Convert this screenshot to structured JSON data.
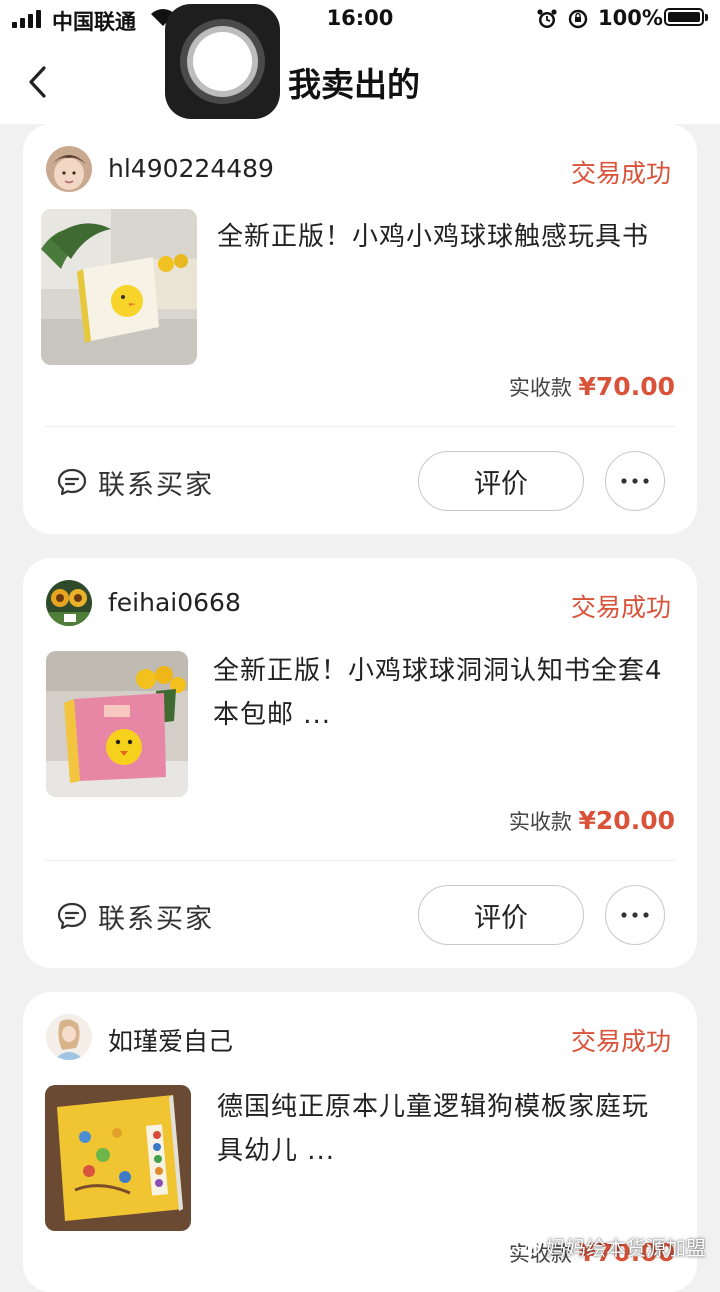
{
  "status_bar": {
    "carrier": "中国联通",
    "time": "16:00",
    "battery": "100%"
  },
  "nav": {
    "title": "我卖出的"
  },
  "orders": [
    {
      "username": "hl490224489",
      "status": "交易成功",
      "title": "全新正版！小鸡小鸡球球触感玩具书",
      "price_label": "实收款",
      "price": "¥70.00",
      "contact_label": "联系买家",
      "review_label": "评价",
      "more_label": "···"
    },
    {
      "username": "feihai0668",
      "status": "交易成功",
      "title": "全新正版！小鸡球球洞洞认知书全套4本包邮 ...",
      "price_label": "实收款",
      "price": "¥20.00",
      "contact_label": "联系买家",
      "review_label": "评价",
      "more_label": "···"
    },
    {
      "username": "如瑾爱自己",
      "status": "交易成功",
      "title": "德国纯正原本儿童逻辑狗模板家庭玩具幼儿 ...",
      "price_label": "实收款",
      "price": "¥70.00"
    }
  ],
  "watermark": "妈妈绘本货源加盟",
  "colors": {
    "accent": "#d9533a",
    "background": "#f1f1f1",
    "card": "#ffffff"
  }
}
